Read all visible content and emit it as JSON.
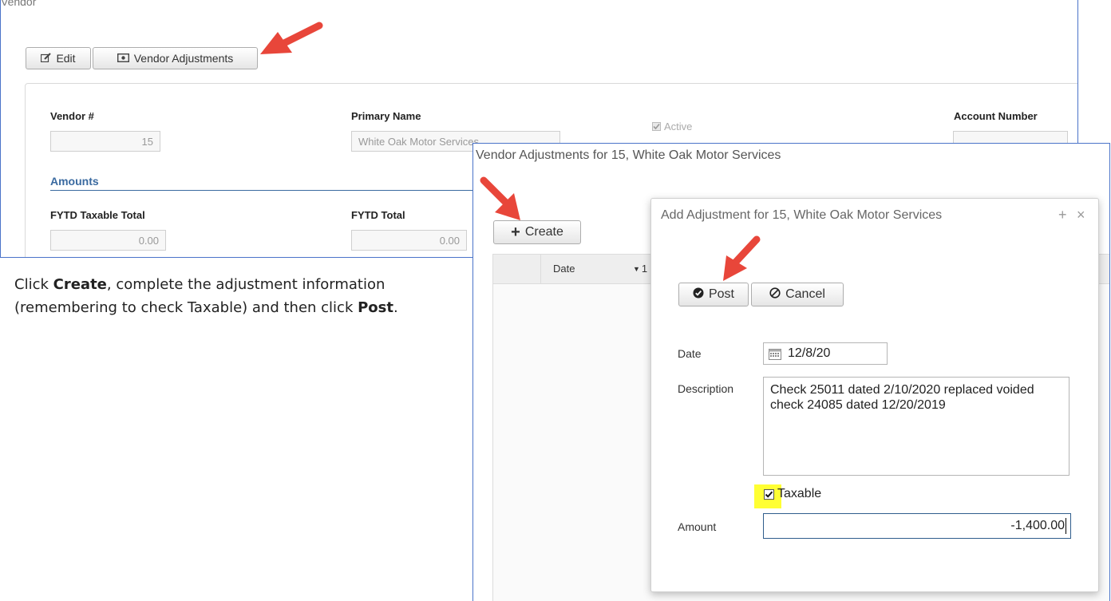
{
  "vendor_panel": {
    "title": "Vendor",
    "edit_label": "Edit",
    "adjustments_label": "Vendor Adjustments",
    "vendor_no_label": "Vendor #",
    "vendor_no_value": "15",
    "primary_name_label": "Primary Name",
    "primary_name_value": "White Oak Motor Services",
    "active_label": "Active",
    "account_number_label": "Account Number",
    "amounts_title": "Amounts",
    "fytd_taxable_label": "FYTD Taxable Total",
    "fytd_taxable_value": "0.00",
    "fytd_total_label": "FYTD Total",
    "fytd_total_value": "0.00"
  },
  "instructions": {
    "part1": "Click ",
    "create": "Create",
    "part2": ", complete the adjustment information (remembering to check Taxable) and then click ",
    "post": "Post",
    "part3": "."
  },
  "adjustments_panel": {
    "title": "Vendor Adjustments for 15, White Oak Motor Services",
    "create_label": "Create",
    "col_date": "Date",
    "col_partial": "1"
  },
  "dialog": {
    "title": "Add Adjustment for 15, White Oak Motor Services",
    "post_label": "Post",
    "cancel_label": "Cancel",
    "date_label": "Date",
    "date_value": "12/8/20",
    "description_label": "Description",
    "description_value": "Check 25011 dated 2/10/2020 replaced voided check 24085 dated 12/20/2019",
    "taxable_label": "Taxable",
    "taxable_checked": true,
    "amount_label": "Amount",
    "amount_value": "-1,400.00"
  },
  "colors": {
    "panel_border": "#4a73c9",
    "arrow": "#e8463a",
    "highlight": "#ffff33",
    "section_title": "#3a6aa0"
  },
  "icons": {
    "edit": "pencil-square-icon",
    "adjustments": "money-icon",
    "create": "plus-icon",
    "post": "check-circle-icon",
    "cancel": "ban-icon",
    "date": "calendar-icon",
    "window_max": "plus-icon",
    "window_close": "close-icon"
  }
}
